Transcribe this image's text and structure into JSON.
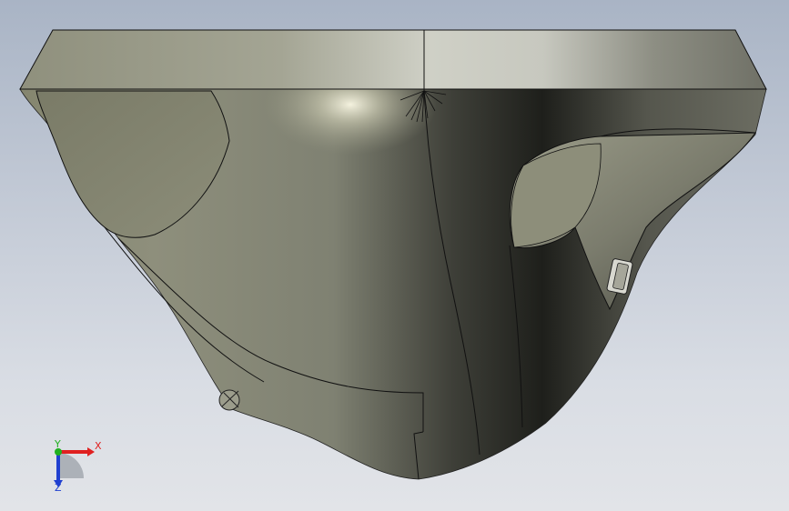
{
  "viewport": {
    "background_top": "#a9b4c5",
    "background_bottom": "#e2e4e8",
    "model_color": "#6d6f62",
    "edge_color": "#111111"
  },
  "triad": {
    "x_label": "X",
    "y_label": "Y",
    "z_label": "Z",
    "x_color": "#e02020",
    "y_color": "#20b020",
    "z_color": "#2040d0"
  }
}
